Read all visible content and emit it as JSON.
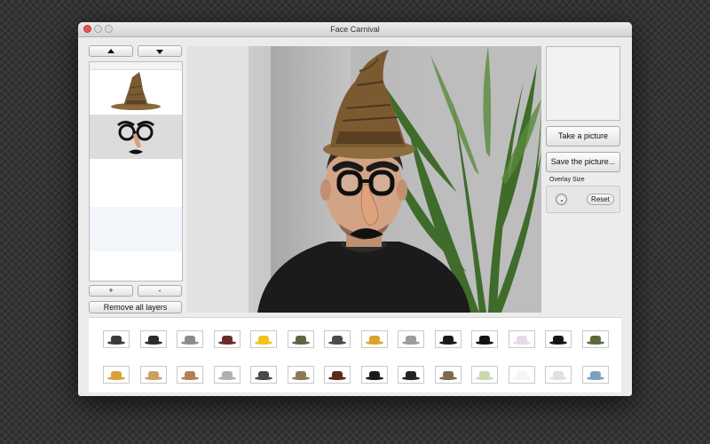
{
  "window": {
    "title": "Face Carnival"
  },
  "layers": {
    "items": [
      {
        "name": "wizard-hat-layer",
        "icon": "wizard-hat-icon",
        "selected": false
      },
      {
        "name": "groucho-glasses-layer",
        "icon": "groucho-glasses-icon",
        "selected": true
      }
    ],
    "add_label": "+",
    "remove_label": "-",
    "remove_all_label": "Remove all layers"
  },
  "controls": {
    "take_picture_label": "Take a picture",
    "save_picture_label": "Save the picture...",
    "overlay_size_label": "Overlay Size",
    "reset_label": "Reset"
  },
  "gallery": {
    "row1": [
      {
        "icon": "flat-cap-icon",
        "color": "#3a3a3a"
      },
      {
        "icon": "flat-cap-icon",
        "color": "#2b2b2b"
      },
      {
        "icon": "fedora-icon",
        "color": "#8a8a8a"
      },
      {
        "icon": "cowboy-hat-icon",
        "color": "#6b2a2a"
      },
      {
        "icon": "hard-hat-icon",
        "color": "#f2c21b"
      },
      {
        "icon": "army-helmet-icon",
        "color": "#5e6440"
      },
      {
        "icon": "army-helmet-icon",
        "color": "#4a4a4a"
      },
      {
        "icon": "crown-icon",
        "color": "#d9a52a"
      },
      {
        "icon": "top-hat-icon",
        "color": "#9c9c9c"
      },
      {
        "icon": "bowler-hat-icon",
        "color": "#1a1a1a"
      },
      {
        "icon": "top-hat-icon",
        "color": "#111111"
      },
      {
        "icon": "baseball-cap-icon",
        "color": "#e8d8e8"
      },
      {
        "icon": "beret-icon",
        "color": "#151515"
      },
      {
        "icon": "camo-cap-icon",
        "color": "#5b6a3a"
      }
    ],
    "row2": [
      {
        "icon": "sun-hat-icon",
        "color": "#d9a03a"
      },
      {
        "icon": "straw-hat-icon",
        "color": "#c9a060"
      },
      {
        "icon": "straw-hat-icon",
        "color": "#b08050"
      },
      {
        "icon": "cap-icon",
        "color": "#b0b0b0"
      },
      {
        "icon": "witch-hat-icon",
        "color": "#4a4a4a"
      },
      {
        "icon": "viking-helmet-icon",
        "color": "#8a7a5a"
      },
      {
        "icon": "chef-hat-icon",
        "color": "#5a2a1a"
      },
      {
        "icon": "pirate-hat-icon",
        "color": "#1a1a1a"
      },
      {
        "icon": "pirate-hat-icon",
        "color": "#222222"
      },
      {
        "icon": "flat-cap-icon",
        "color": "#7a6a50"
      },
      {
        "icon": "sombrero-icon",
        "color": "#c8d8b0"
      },
      {
        "icon": "chef-hat-icon",
        "color": "#f4f4f4"
      },
      {
        "icon": "bandana-icon",
        "color": "#e0e0e0"
      },
      {
        "icon": "goggles-icon",
        "color": "#7ea0c0"
      }
    ]
  },
  "colors": {
    "close_button": "#e9544f",
    "accent_selected": "#dcdcdc"
  }
}
